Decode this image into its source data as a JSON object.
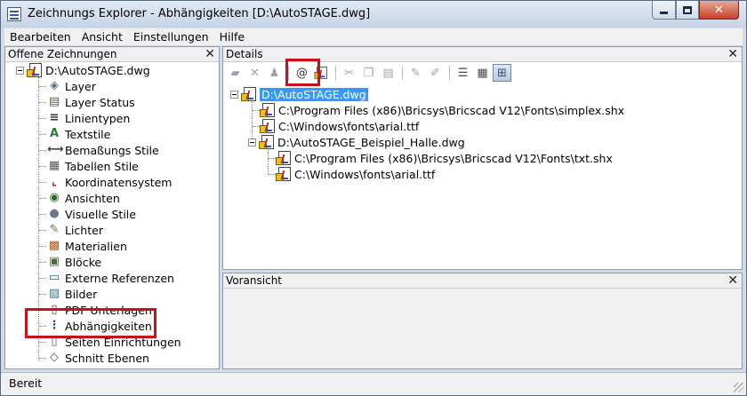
{
  "window": {
    "title": "Zeichnungs Explorer - Abhängigkeiten [D:\\AutoSTAGE.dwg]"
  },
  "menu": [
    "Bearbeiten",
    "Ansicht",
    "Einstellungen",
    "Hilfe"
  ],
  "left_panel": {
    "header": "Offene Zeichnungen",
    "root": "D:\\AutoSTAGE.dwg",
    "items": [
      {
        "label": "Layer",
        "icon": "layer-icon"
      },
      {
        "label": "Layer Status",
        "icon": "layer-status-icon"
      },
      {
        "label": "Linientypen",
        "icon": "linetype-icon"
      },
      {
        "label": "Textstile",
        "icon": "textstyle-icon"
      },
      {
        "label": "Bemaßungs Stile",
        "icon": "dimstyle-icon"
      },
      {
        "label": "Tabellen Stile",
        "icon": "tablestyle-icon"
      },
      {
        "label": "Koordinatensystem",
        "icon": "ucs-icon"
      },
      {
        "label": "Ansichten",
        "icon": "view-icon"
      },
      {
        "label": "Visuelle Stile",
        "icon": "visualstyle-icon"
      },
      {
        "label": "Lichter",
        "icon": "light-icon"
      },
      {
        "label": "Materialien",
        "icon": "material-icon"
      },
      {
        "label": "Blöcke",
        "icon": "block-icon"
      },
      {
        "label": "Externe Referenzen",
        "icon": "xref-icon"
      },
      {
        "label": "Bilder",
        "icon": "image-icon"
      },
      {
        "label": "PDF Unterlagen",
        "icon": "pdf-icon"
      },
      {
        "label": "Abhängigkeiten",
        "icon": "dependency-icon"
      },
      {
        "label": "Seiten Einrichtungen",
        "icon": "page-setup-icon"
      },
      {
        "label": "Schnitt Ebenen",
        "icon": "section-plane-icon"
      }
    ]
  },
  "details_panel": {
    "header": "Details",
    "tree": {
      "root": "D:\\AutoSTAGE.dwg",
      "children": [
        "C:\\Program Files (x86)\\Bricsys\\Bricscad V12\\Fonts\\simplex.shx",
        "C:\\Windows\\fonts\\arial.ttf",
        "D:\\AutoSTAGE_Beispiel_Halle.dwg"
      ],
      "grandchildren": [
        "C:\\Program Files (x86)\\Bricsys\\Bricscad V12\\Fonts\\txt.shx",
        "C:\\Windows\\fonts\\arial.ttf"
      ]
    }
  },
  "preview_panel": {
    "header": "Voransicht"
  },
  "status": "Bereit",
  "colors": {
    "highlight": "#c8101d",
    "selection": "#3399ff"
  }
}
